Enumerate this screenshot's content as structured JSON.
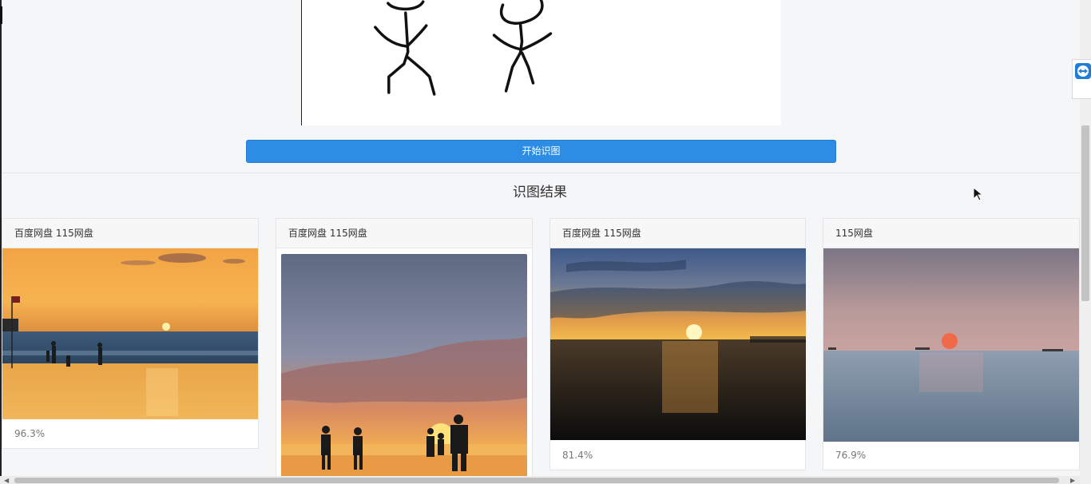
{
  "actions": {
    "start_label": "开始识图"
  },
  "results": {
    "title": "识图结果",
    "cards": [
      {
        "source": "百度网盘 115网盘",
        "score": "96.3%"
      },
      {
        "source": "百度网盘 115网盘",
        "score": ""
      },
      {
        "source": "百度网盘 115网盘",
        "score": "81.4%"
      },
      {
        "source": "115网盘",
        "score": "76.9%"
      }
    ]
  },
  "colors": {
    "primary": "#2d8ce4"
  },
  "icons": {
    "remote_tool": "teamviewer-icon",
    "cursor": "mouse-cursor-icon"
  }
}
